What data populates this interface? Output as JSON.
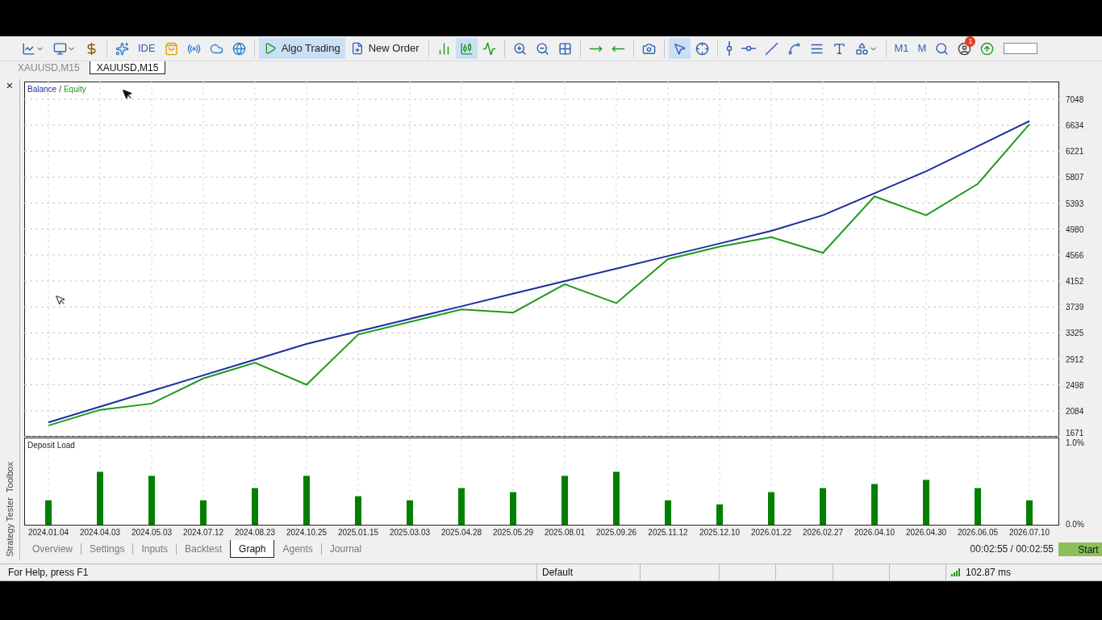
{
  "toolbar": [
    {
      "kind": "icon",
      "dropdown": true,
      "selected": false
    },
    {
      "kind": "icon",
      "dropdown": true,
      "selected": false
    },
    {
      "kind": "icon",
      "selected": false
    },
    {
      "kind": "separator"
    },
    {
      "kind": "icon",
      "selected": false
    },
    {
      "kind": "text",
      "label": "IDE",
      "selected": false
    },
    {
      "kind": "icon",
      "selected": false
    },
    {
      "kind": "icon",
      "selected": false
    },
    {
      "kind": "icon",
      "selected": false
    },
    {
      "kind": "icon",
      "selected": false
    },
    {
      "kind": "separator"
    },
    {
      "kind": "labeled",
      "label": "Algo Trading",
      "selected": true
    },
    {
      "kind": "labeled",
      "label": "New Order",
      "selected": false
    },
    {
      "kind": "separator"
    },
    {
      "kind": "icon",
      "selected": false
    },
    {
      "kind": "icon",
      "selected": true
    },
    {
      "kind": "icon",
      "selected": false
    },
    {
      "kind": "separator"
    },
    {
      "kind": "icon",
      "selected": false
    },
    {
      "kind": "icon",
      "selected": false
    },
    {
      "kind": "icon",
      "selected": false
    },
    {
      "kind": "separator"
    },
    {
      "kind": "icon",
      "selected": false
    },
    {
      "kind": "icon",
      "selected": false
    },
    {
      "kind": "separator"
    },
    {
      "kind": "icon",
      "selected": false
    },
    {
      "kind": "separator"
    },
    {
      "kind": "icon",
      "selected": true
    },
    {
      "kind": "icon",
      "selected": false
    },
    {
      "kind": "separator"
    },
    {
      "kind": "icon",
      "selected": false
    },
    {
      "kind": "icon",
      "selected": false
    },
    {
      "kind": "icon",
      "selected": false
    },
    {
      "kind": "icon",
      "selected": false
    },
    {
      "kind": "icon",
      "selected": false
    },
    {
      "kind": "icon",
      "selected": false
    },
    {
      "kind": "icon",
      "dropdown": true,
      "selected": false
    },
    {
      "kind": "separator"
    },
    {
      "kind": "text",
      "label": "M1",
      "selected": false
    },
    {
      "kind": "text",
      "label": "M",
      "selected": false
    },
    {
      "kind": "icon",
      "selected": false
    },
    {
      "kind": "icon",
      "badge": "1",
      "selected": false
    },
    {
      "kind": "icon",
      "selected": false
    },
    {
      "kind": "field"
    }
  ],
  "chart_tabs": [
    {
      "label": "XAUUSD,M15",
      "selected": false
    },
    {
      "label": "XAUUSD,M15",
      "selected": true
    }
  ],
  "side_panel": {
    "close": "×",
    "labels": [
      "Toolbox",
      "Strategy Tester"
    ]
  },
  "balance_chart": {
    "legend_separator": "/",
    "chart_data": {
      "type": "line",
      "grid": true,
      "series": [
        {
          "name": "Balance",
          "color": "#1a2e9e",
          "values": [
            1900,
            2150,
            2400,
            2650,
            2900,
            3150,
            3350,
            3550,
            3750,
            3950,
            4150,
            4350,
            4550,
            4750,
            4950,
            5200,
            5550,
            5900,
            6300,
            6700
          ]
        },
        {
          "name": "Equity",
          "color": "#1e9a1e",
          "values": [
            1850,
            2100,
            2200,
            2600,
            2850,
            2500,
            3300,
            3500,
            3700,
            3650,
            4100,
            3800,
            4500,
            4700,
            4850,
            4600,
            5500,
            5200,
            5700,
            6650
          ]
        }
      ],
      "ylim": [
        1671,
        7330
      ],
      "yticks": [
        1671,
        2084,
        2498,
        2912,
        3325,
        3739,
        4152,
        4566,
        4980,
        5393,
        5807,
        6221,
        6634,
        7048
      ]
    }
  },
  "deposit_chart": {
    "chart_data": {
      "type": "bar",
      "grid": true,
      "categories": [
        "2024.01.04",
        "2024.04.03",
        "2024.05.03",
        "2024.07.12",
        "2024.08.23",
        "2024.10.25",
        "2025.01.15",
        "2025.03.03",
        "2025.04.28",
        "2025.05.29",
        "2025.08.01",
        "2025.09.26",
        "2025.11.12",
        "2025.12.10",
        "2026.01.22",
        "2026.02.27",
        "2026.04.10",
        "2026.04.30",
        "2026.06.05",
        "2026.07.10"
      ],
      "series": [
        {
          "name": "Deposit Load",
          "color": "#008000",
          "values": [
            0.3,
            0.65,
            0.6,
            0.3,
            0.45,
            0.6,
            0.35,
            0.3,
            0.45,
            0.4,
            0.6,
            0.65,
            0.3,
            0.25,
            0.4,
            0.45,
            0.5,
            0.55,
            0.45,
            0.3
          ]
        }
      ],
      "ylim": [
        0,
        1.06
      ],
      "yticks": [
        {
          "value": 0,
          "label": "0.0%"
        },
        {
          "value": 1,
          "label": "1.0%"
        }
      ]
    }
  },
  "tester_tabs": [
    {
      "label": "Overview",
      "selected": false
    },
    {
      "label": "Settings",
      "selected": false
    },
    {
      "label": "Inputs",
      "selected": false
    },
    {
      "label": "Backtest",
      "selected": false
    },
    {
      "label": "Graph",
      "selected": true
    },
    {
      "label": "Agents",
      "selected": false
    },
    {
      "label": "Journal",
      "selected": false
    }
  ],
  "timer": "00:02:55 / 00:02:55",
  "start_button": "Start",
  "status_bar": {
    "help": "For Help, press F1",
    "profile": "Default",
    "ping": "102.87 ms"
  }
}
